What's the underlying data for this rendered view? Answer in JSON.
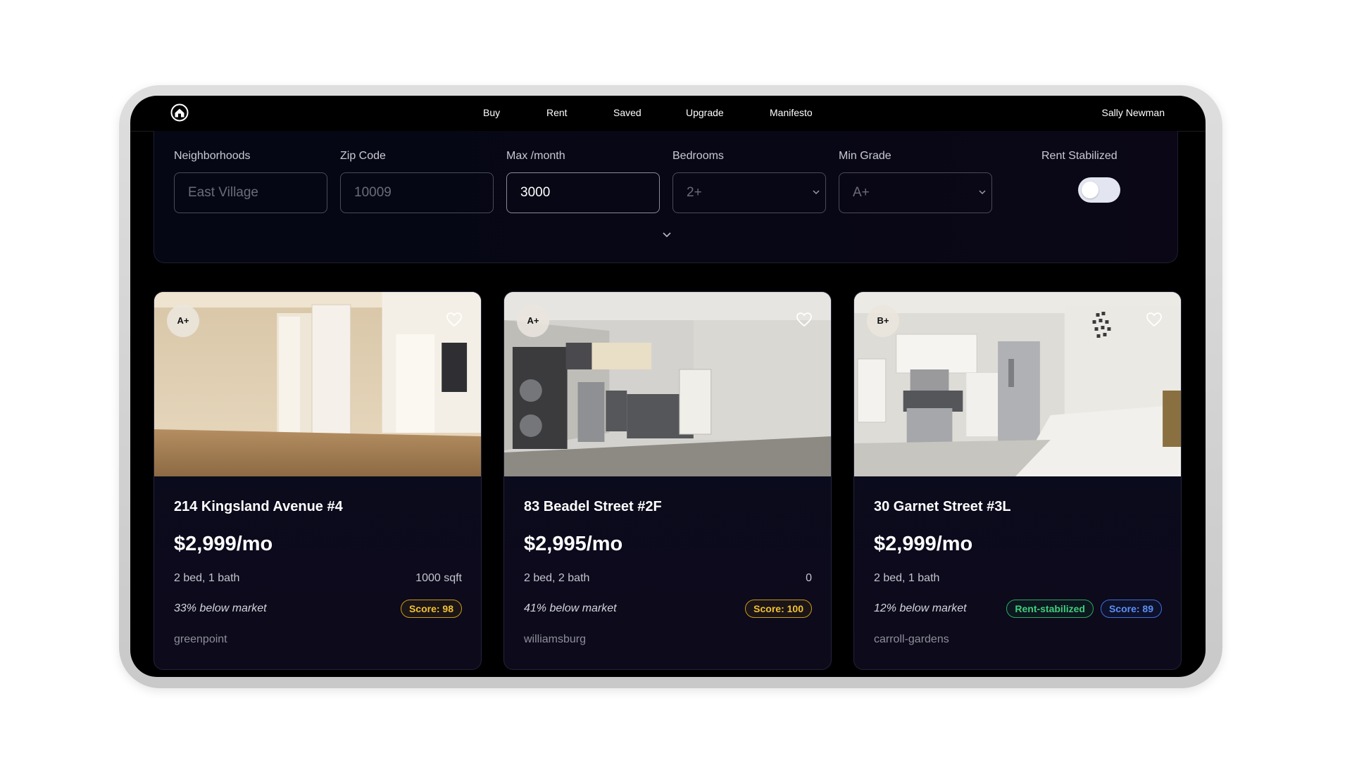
{
  "nav": {
    "links": [
      "Buy",
      "Rent",
      "Saved",
      "Upgrade",
      "Manifesto"
    ],
    "active": "Rent",
    "user": "Sally Newman"
  },
  "filters": {
    "neighborhoods": {
      "label": "Neighborhoods",
      "placeholder": "East Village"
    },
    "zip": {
      "label": "Zip Code",
      "placeholder": "10009"
    },
    "max": {
      "label": "Max /month",
      "value": "3000"
    },
    "bedrooms": {
      "label": "Bedrooms",
      "value": "2+"
    },
    "grade": {
      "label": "Min Grade",
      "value": "A+"
    },
    "rent_stabilized": {
      "label": "Rent Stabilized",
      "on": false
    }
  },
  "listings": [
    {
      "grade": "A+",
      "address": "214 Kingsland Avenue #4",
      "price": "$2,999/mo",
      "beds": "2 bed, 1 bath",
      "sqft": "1000 sqft",
      "market": "33% below market",
      "badges": [
        {
          "text": "Score: 98",
          "style": "score-gold"
        }
      ],
      "neighborhood": "greenpoint"
    },
    {
      "grade": "A+",
      "address": "83 Beadel Street #2F",
      "price": "$2,995/mo",
      "beds": "2 bed, 2 bath",
      "sqft": "0",
      "market": "41% below market",
      "badges": [
        {
          "text": "Score: 100",
          "style": "score-gold"
        }
      ],
      "neighborhood": "williamsburg"
    },
    {
      "grade": "B+",
      "address": "30 Garnet Street #3L",
      "price": "$2,999/mo",
      "beds": "2 bed, 1 bath",
      "sqft": "",
      "market": "12% below market",
      "badges": [
        {
          "text": "Rent-stabilized",
          "style": "rent-green"
        },
        {
          "text": "Score: 89",
          "style": "score-blue"
        }
      ],
      "neighborhood": "carroll-gardens"
    }
  ],
  "icons": {
    "logo": "home-logo-icon",
    "favorite": "heart-icon",
    "dropdown": "chevron-down-icon",
    "expand": "chevron-down-icon"
  },
  "colors": {
    "background": "#000000",
    "score_gold": "#f2c233",
    "score_blue": "#5b8ff5",
    "rent_green": "#3ecf7d"
  }
}
